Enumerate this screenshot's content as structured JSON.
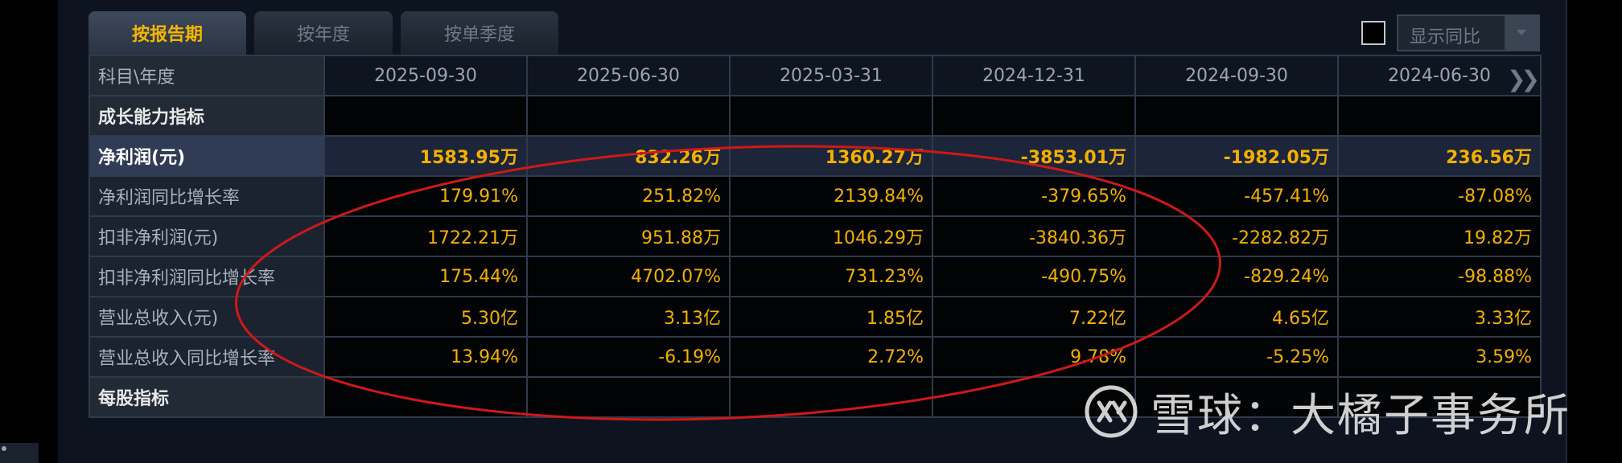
{
  "tabs": [
    {
      "label": "按报告期",
      "active": true
    },
    {
      "label": "按年度",
      "active": false
    },
    {
      "label": "按单季度",
      "active": false
    }
  ],
  "yoy_toggle": {
    "label": "显示同比",
    "checked": false
  },
  "table": {
    "corner_label": "科目\\年度",
    "columns": [
      "2025-09-30",
      "2025-06-30",
      "2025-03-31",
      "2024-12-31",
      "2024-09-30",
      "2024-06-30"
    ],
    "next_icon": "double-chevron-right-icon",
    "rows": [
      {
        "label": "成长能力指标",
        "type": "section",
        "values": [
          "",
          "",
          "",
          "",
          "",
          ""
        ]
      },
      {
        "label": "净利润(元)",
        "type": "highlight",
        "values": [
          "1583.95万",
          "832.26万",
          "1360.27万",
          "-3853.01万",
          "-1982.05万",
          "236.56万"
        ]
      },
      {
        "label": "净利润同比增长率",
        "type": "data",
        "values": [
          "179.91%",
          "251.82%",
          "2139.84%",
          "-379.65%",
          "-457.41%",
          "-87.08%"
        ]
      },
      {
        "label": "扣非净利润(元)",
        "type": "data",
        "values": [
          "1722.21万",
          "951.88万",
          "1046.29万",
          "-3840.36万",
          "-2282.82万",
          "19.82万"
        ]
      },
      {
        "label": "扣非净利润同比增长率",
        "type": "data",
        "values": [
          "175.44%",
          "4702.07%",
          "731.23%",
          "-490.75%",
          "-829.24%",
          "-98.88%"
        ]
      },
      {
        "label": "营业总收入(元)",
        "type": "data",
        "values": [
          "5.30亿",
          "3.13亿",
          "1.85亿",
          "7.22亿",
          "4.65亿",
          "3.33亿"
        ]
      },
      {
        "label": "营业总收入同比增长率",
        "type": "data",
        "values": [
          "13.94%",
          "-6.19%",
          "2.72%",
          "9.78%",
          "-5.25%",
          "3.59%"
        ]
      },
      {
        "label": "每股指标",
        "type": "section",
        "values": [
          "",
          "",
          "",
          "",
          "",
          ""
        ]
      }
    ]
  },
  "annotation": {
    "shape": "ellipse",
    "color": "#d01818"
  },
  "watermark": {
    "text": "雪球：大橘子事务所",
    "logo_icon": "xueqiu-logo-icon"
  },
  "colors": {
    "accent": "#f4b000",
    "background": "#0d1420",
    "annotation": "#d01818"
  }
}
